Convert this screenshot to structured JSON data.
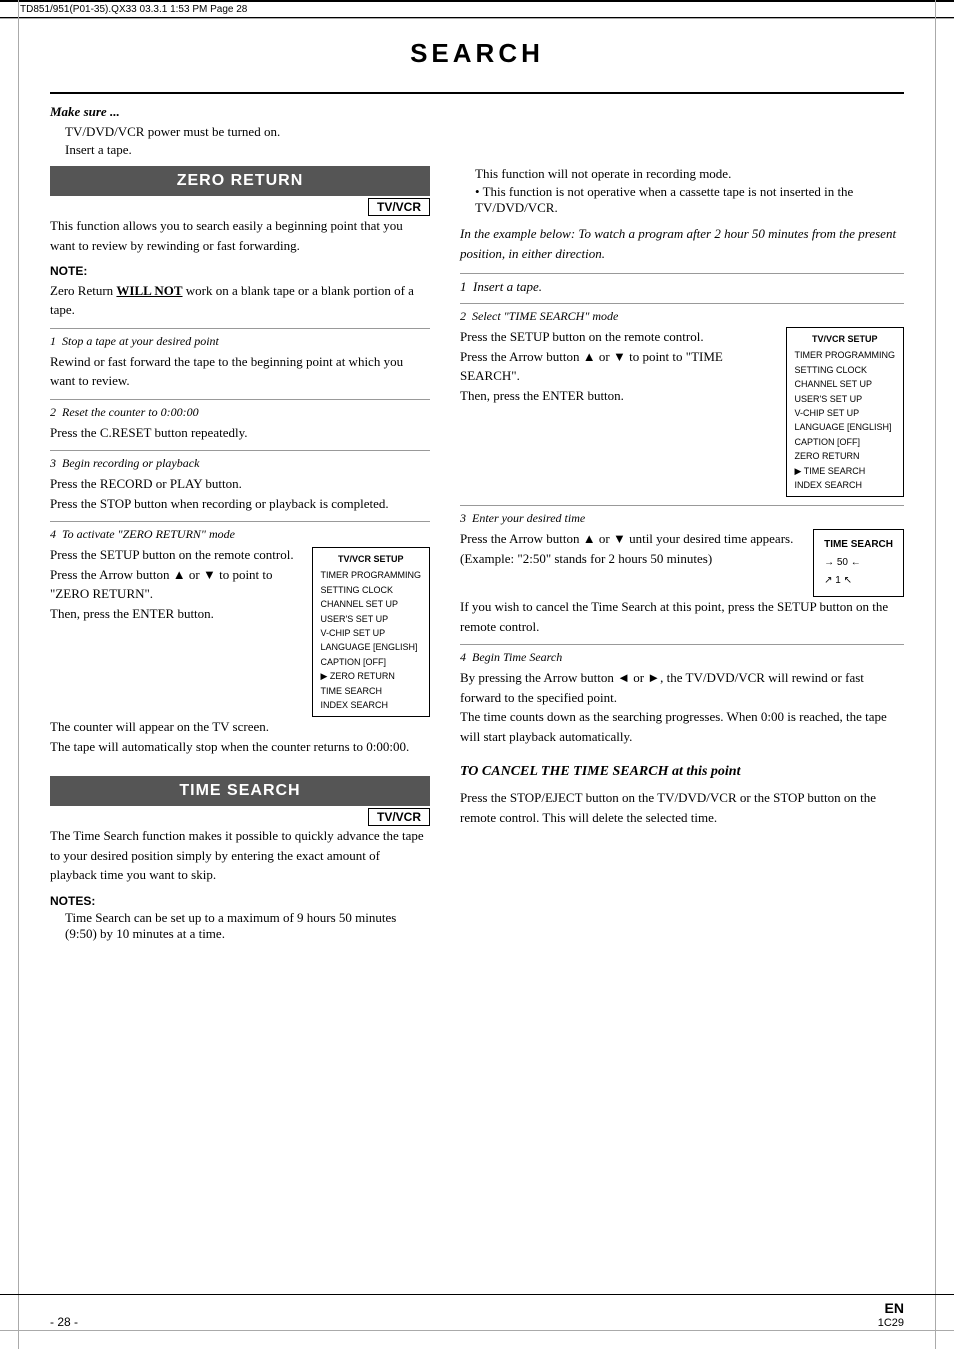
{
  "page": {
    "header": {
      "file_info": "TD851/951(P01-35).QX33  03.3.1  1:53 PM  Page 28"
    },
    "title": "SEARCH",
    "make_sure": {
      "label": "Make sure ...",
      "bullets": [
        "TV/DVD/VCR power must be turned on.",
        "Insert a tape."
      ]
    }
  },
  "zero_return": {
    "section_title": "ZERO RETURN",
    "badge": "TV/VCR",
    "description": "This function allows you to search easily a beginning point that you want to review by rewinding or fast forwarding.",
    "note_label": "NOTE:",
    "note_text": "Zero Return WILL NOT work on a blank tape or a blank portion of a tape.",
    "steps": [
      {
        "num": "1",
        "title": "Stop a tape at your desired point",
        "body": "Rewind or fast forward the tape to the beginning point at which you want to review."
      },
      {
        "num": "2",
        "title": "Reset the counter to 0:00:00",
        "body": "Press the C.RESET button repeatedly."
      },
      {
        "num": "3",
        "title": "Begin recording or playback",
        "body1": "Press the RECORD or PLAY button.",
        "body2": "Press the STOP button when recording or playback is completed."
      },
      {
        "num": "4",
        "title": "To activate \"ZERO RETURN\" mode",
        "body1": "Press the SETUP button on the remote control.",
        "body2": "Press the Arrow button ▲ or ▼ to point to \"ZERO RETURN\".",
        "body3": "Then, press the ENTER button.",
        "body4": "The counter will appear on the TV screen.",
        "body5": "The tape will automatically stop when the counter returns to 0:00:00."
      }
    ],
    "menu": {
      "title": "TV/VCR SETUP",
      "items": [
        "TIMER PROGRAMMING",
        "SETTING CLOCK",
        "CHANNEL SET UP",
        "USER'S SET UP",
        "V-CHIP SET UP",
        "LANGUAGE [ENGLISH]",
        "CAPTION [OFF]",
        "ZERO RETURN",
        "TIME SEARCH",
        "INDEX SEARCH"
      ],
      "selected": "ZERO RETURN"
    }
  },
  "time_search": {
    "section_title": "TIME SEARCH",
    "badge": "TV/VCR",
    "description": "The Time Search function makes it possible to quickly advance the tape to your desired position simply by entering the exact amount of playback time you want to skip.",
    "notes_label": "NOTES:",
    "notes": [
      "Time Search can be set up to a maximum of 9 hours 50 minutes (9:50) by 10 minutes at a time."
    ],
    "right_col": {
      "bullets": [
        "This function will not operate in recording mode.",
        "This function is not operative when a cassette tape is not inserted in the TV/DVD/VCR."
      ],
      "example_text": "In the example below: To watch a program after 2 hour 50 minutes from the present position, in either direction.",
      "steps": [
        {
          "num": "1",
          "title": "Insert a tape.",
          "body": ""
        },
        {
          "num": "2",
          "title": "Select \"TIME SEARCH\" mode",
          "body1": "Press the SETUP button on the remote control.",
          "body2": "Press the Arrow button ▲ or ▼ to point to \"TIME SEARCH\".",
          "body3": "Then, press the ENTER button."
        },
        {
          "num": "3",
          "title": "Enter your desired time",
          "body1": "Press the Arrow button ▲ or ▼ until your desired time appears.",
          "body2": "(Example: \"2:50\" stands for 2 hours 50 minutes)",
          "body3": "If you wish to cancel the Time Search at this point, press the SETUP button on the remote control."
        },
        {
          "num": "4",
          "title": "Begin Time Search",
          "body1": "By pressing the Arrow button ◄ or ►, the TV/DVD/VCR will rewind or fast forward to the specified point.",
          "body2": "The time counts down as the searching progresses. When 0:00 is reached, the tape will start playback automatically."
        }
      ],
      "menu": {
        "title": "TV/VCR SETUP",
        "items": [
          "TIMER PROGRAMMING",
          "SETTING CLOCK",
          "CHANNEL SET UP",
          "USER'S SET UP",
          "V-CHIP SET UP",
          "LANGUAGE [ENGLISH]",
          "CAPTION [OFF]",
          "ZERO RETURN",
          "TIME SEARCH",
          "INDEX SEARCH"
        ],
        "selected": "TIME SEARCH"
      },
      "time_display": {
        "line1": "TIME SEARCH",
        "line2": "→  50 ←",
        "line3": "↗  1 ↖"
      },
      "cancel_section": {
        "heading": "TO CANCEL THE TIME SEARCH at this point",
        "body": "Press the STOP/EJECT button on the TV/DVD/VCR or the STOP button on the remote control. This will delete the selected time."
      }
    }
  },
  "footer": {
    "page_num": "- 28 -",
    "lang": "EN",
    "code": "1C29"
  }
}
